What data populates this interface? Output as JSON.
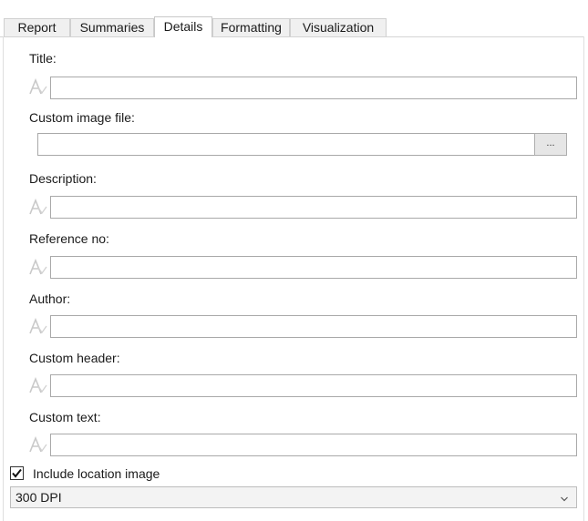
{
  "tabs": [
    {
      "label": "Report"
    },
    {
      "label": "Summaries"
    },
    {
      "label": "Details",
      "active": true
    },
    {
      "label": "Formatting"
    },
    {
      "label": "Visualization"
    }
  ],
  "fields": {
    "title": {
      "label": "Title:",
      "value": ""
    },
    "custom_image_file": {
      "label": "Custom image file:",
      "value": "",
      "browse_label": "..."
    },
    "description": {
      "label": "Description:",
      "value": ""
    },
    "reference_no": {
      "label": "Reference no:",
      "value": ""
    },
    "author": {
      "label": "Author:",
      "value": ""
    },
    "custom_header": {
      "label": "Custom header:",
      "value": ""
    },
    "custom_text": {
      "label": "Custom text:",
      "value": ""
    }
  },
  "include_location_image": {
    "label": "Include location image",
    "checked": true
  },
  "resolution_select": {
    "value": "300 DPI"
  },
  "icons": {
    "translate": "translate-icon",
    "check": "checkmark-icon",
    "dropdown": "chevron-down-icon"
  }
}
